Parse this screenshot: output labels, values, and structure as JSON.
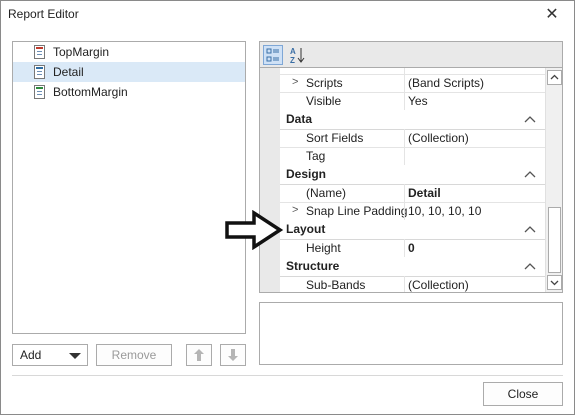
{
  "window": {
    "title": "Report Editor"
  },
  "bands": {
    "items": [
      {
        "label": "TopMargin",
        "color": "#c0392b",
        "selected": false
      },
      {
        "label": "Detail",
        "color": "#2e6da4",
        "selected": true
      },
      {
        "label": "BottomMargin",
        "color": "#2e8b3d",
        "selected": false
      }
    ]
  },
  "controls": {
    "add_label": "Add",
    "remove_label": "Remove",
    "close_label": "Close"
  },
  "properties": {
    "rows": [
      {
        "kind": "prop",
        "name": "Scripts",
        "value": "(Band Scripts)",
        "expandable": true,
        "bold": false
      },
      {
        "kind": "prop",
        "name": "Visible",
        "value": "Yes",
        "expandable": false,
        "bold": false
      },
      {
        "kind": "cat",
        "name": "Data"
      },
      {
        "kind": "prop",
        "name": "Sort Fields",
        "value": "(Collection)",
        "expandable": false,
        "bold": false
      },
      {
        "kind": "prop",
        "name": "Tag",
        "value": "",
        "expandable": false,
        "bold": false
      },
      {
        "kind": "cat",
        "name": "Design"
      },
      {
        "kind": "prop",
        "name": "(Name)",
        "value": "Detail",
        "expandable": false,
        "bold": true
      },
      {
        "kind": "prop",
        "name": "Snap Line Padding",
        "value": "10, 10, 10, 10",
        "expandable": true,
        "bold": false
      },
      {
        "kind": "cat",
        "name": "Layout"
      },
      {
        "kind": "prop",
        "name": "Height",
        "value": "0",
        "expandable": false,
        "bold": true
      },
      {
        "kind": "cat",
        "name": "Structure"
      },
      {
        "kind": "prop",
        "name": "Sub-Bands",
        "value": "(Collection)",
        "expandable": false,
        "bold": false
      }
    ]
  },
  "icons": {
    "close": "close-icon",
    "categorized": "categorized-view-icon",
    "alphabetical": "alphabetical-sort-icon",
    "move_up": "arrow-up-icon",
    "move_down": "arrow-down-icon",
    "collapse": "chevron-up-icon",
    "expand_row": "chevron-right-icon",
    "annotation": "outline-arrow-right-icon"
  },
  "colors": {
    "selection": "#dae9f7",
    "accent": "#7fa7d6"
  }
}
